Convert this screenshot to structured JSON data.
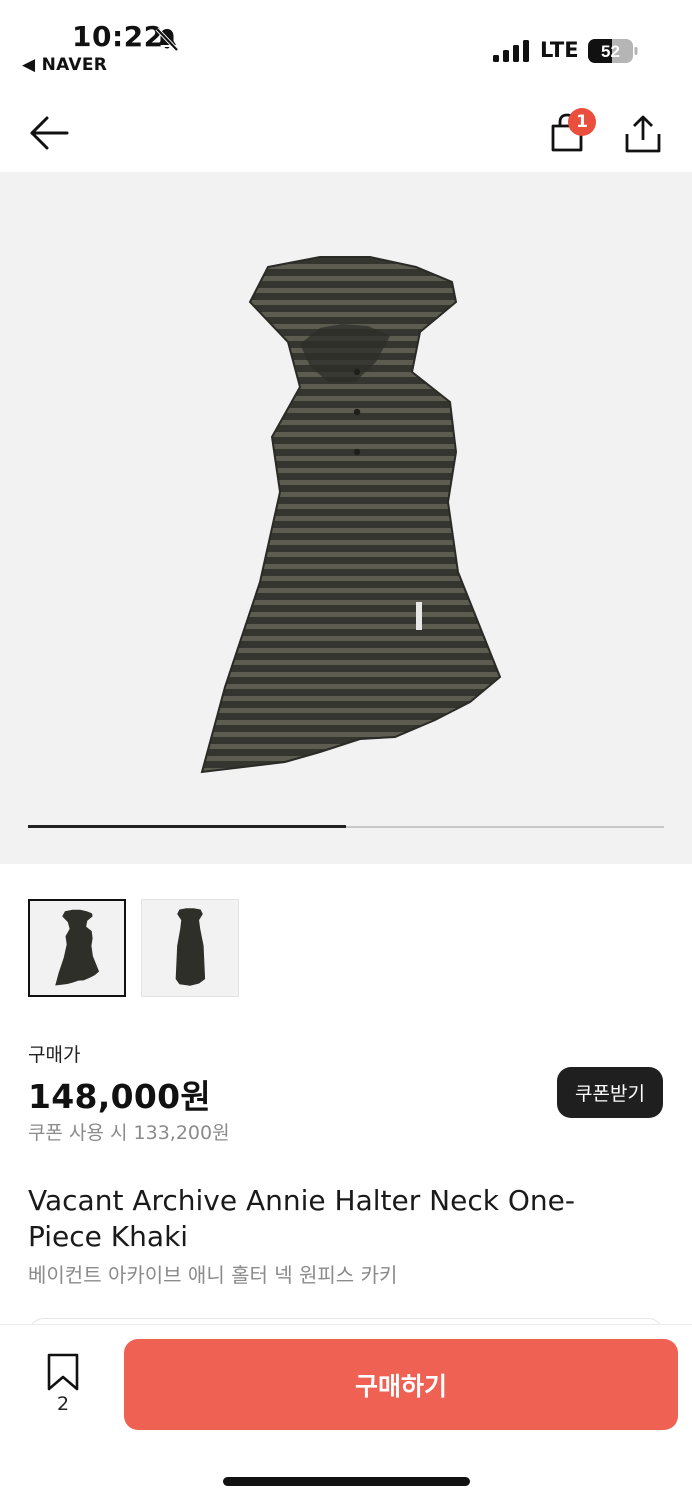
{
  "status_bar": {
    "time": "10:22",
    "back_app": "◀ NAVER",
    "carrier": "LTE",
    "battery": "52",
    "icons": [
      "bell-muted-icon",
      "signal-icon",
      "battery-icon"
    ]
  },
  "nav": {
    "icons": [
      "back-arrow-icon",
      "shopping-bag-icon",
      "share-icon"
    ],
    "cart_badge": "1"
  },
  "gallery": {
    "progress": 0.5,
    "thumbnail_count": 2
  },
  "price": {
    "label": "구매가",
    "value": "148,000원",
    "coupon_text": "쿠폰 사용 시 133,200원",
    "coupon_button": "쿠폰받기"
  },
  "product": {
    "title_en": "Vacant Archive Annie Halter Neck One-Piece Khaki",
    "title_ko": "베이컨트 아카이브 애니 홀터 넥 원피스 카키"
  },
  "bottom_bar": {
    "bookmark_count": "2",
    "buy_label": "구매하기"
  },
  "colors": {
    "accent": "#ef6153",
    "badge": "#ea4e3d",
    "coupon_button_bg": "#1f1f1f",
    "image_bg": "#f2f2f2"
  }
}
